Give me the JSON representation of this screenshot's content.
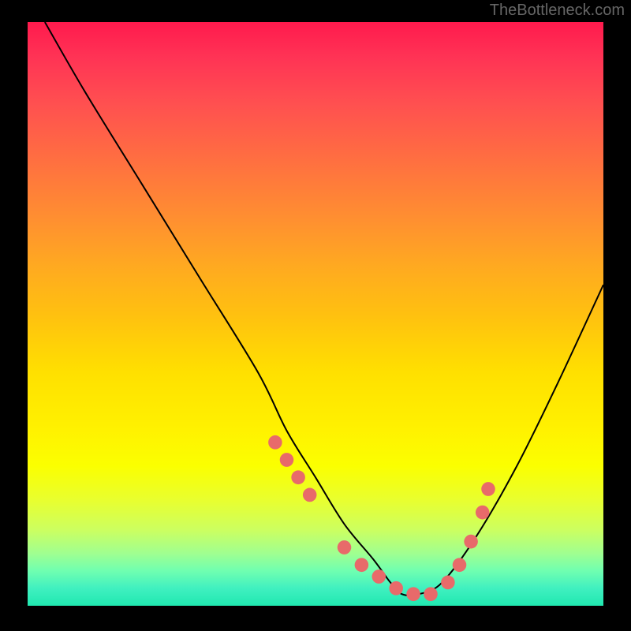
{
  "watermark": "TheBottleneck.com",
  "chart_data": {
    "type": "line",
    "title": "",
    "xlabel": "",
    "ylabel": "",
    "xlim": [
      0,
      100
    ],
    "ylim": [
      0,
      100
    ],
    "gradient_stops": [
      {
        "pos": 0,
        "color": "#ff1a4d"
      },
      {
        "pos": 50,
        "color": "#ffc010"
      },
      {
        "pos": 80,
        "color": "#fbff00"
      },
      {
        "pos": 100,
        "color": "#20e8b0"
      }
    ],
    "series": [
      {
        "name": "bottleneck-curve",
        "x": [
          3,
          10,
          20,
          30,
          40,
          45,
          50,
          55,
          60,
          63,
          65,
          68,
          72,
          78,
          85,
          92,
          100
        ],
        "y": [
          100,
          88,
          72,
          56,
          40,
          30,
          22,
          14,
          8,
          4,
          2,
          2,
          4,
          12,
          24,
          38,
          55
        ]
      }
    ],
    "markers": {
      "x": [
        43,
        45,
        47,
        49,
        55,
        58,
        61,
        64,
        67,
        70,
        73,
        75,
        77,
        79,
        80
      ],
      "y": [
        28,
        25,
        22,
        19,
        10,
        7,
        5,
        3,
        2,
        2,
        4,
        7,
        11,
        16,
        20
      ],
      "color": "#e86a6a",
      "radius": 9
    }
  }
}
